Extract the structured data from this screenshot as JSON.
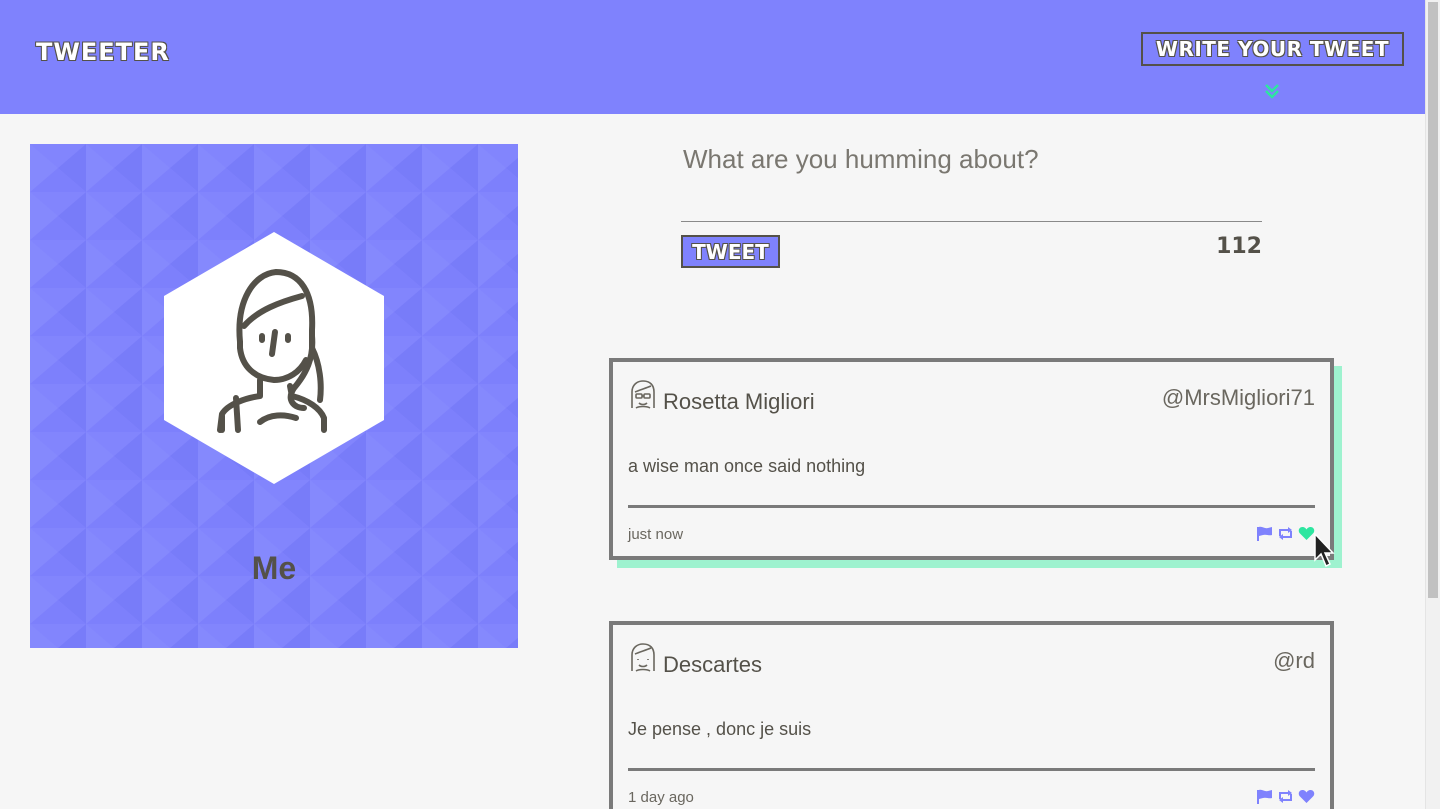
{
  "header": {
    "brand": "Tweeter",
    "write_button": "Write your tweet",
    "toggle_icon": "chevron-double-down-icon"
  },
  "profile": {
    "name": "Me",
    "avatar_icon": "woman-avatar-icon"
  },
  "composer": {
    "placeholder": "What are you humming about?",
    "submit_label": "Tweet",
    "char_count": "112"
  },
  "tweets": [
    {
      "name": "Rosetta Migliori",
      "handle": "@MrsMigliori71",
      "text": "a wise man once said nothing",
      "time": "just now",
      "avatar_icon": "glasses-woman-avatar-icon"
    },
    {
      "name": "Descartes",
      "handle": "@rd",
      "text": "Je pense , donc je suis",
      "time": "1 day ago",
      "avatar_icon": "woman-avatar-icon"
    }
  ],
  "colors": {
    "accent": "#7f82fd",
    "text": "#545149",
    "hover_shadow": "#9ef2cf",
    "liked": "#2ee6a0",
    "background": "#f6f6f6"
  }
}
